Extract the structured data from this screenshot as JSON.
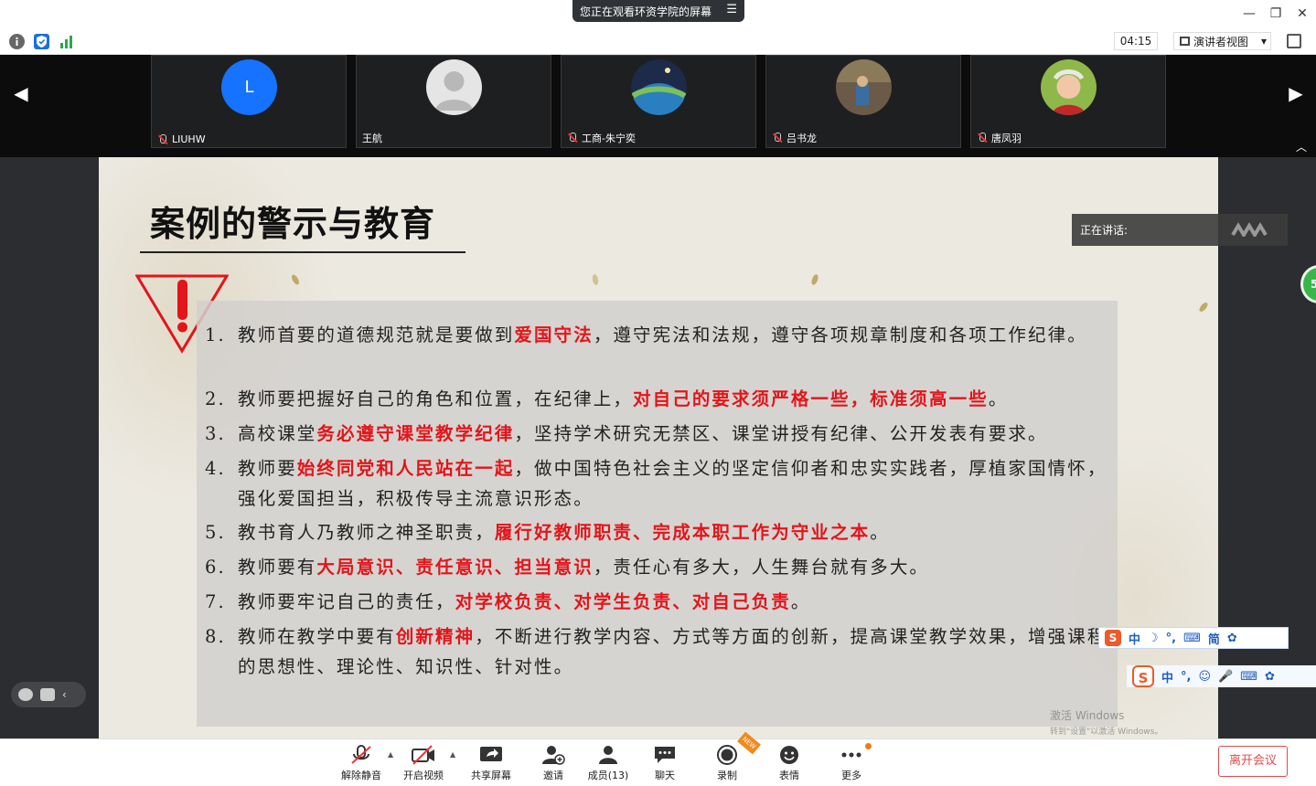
{
  "window": {
    "share_banner": "您正在观看环资学院的屏幕",
    "share_menu_glyph": "☰",
    "minimize_glyph": "—",
    "restore_glyph": "❐",
    "close_glyph": "✕"
  },
  "toolbar": {
    "timer": "04:15",
    "view_label": "演讲者视图",
    "view_caret": "▾"
  },
  "video_strip": {
    "prev_glyph": "◀",
    "next_glyph": "▶",
    "collapse_glyph": "︿",
    "participants": [
      {
        "name": "LIUHW",
        "initial": "L",
        "avatar_color": "#1673ff",
        "muted": true
      },
      {
        "name": "王航",
        "initial": "",
        "avatar_color": "#d9d9d9",
        "muted": false
      },
      {
        "name": "工商-朱宁奕",
        "initial": "",
        "avatar_color": "#1d2a4a",
        "muted": true
      },
      {
        "name": "吕书龙",
        "initial": "",
        "avatar_color": "#6b5a47",
        "muted": true
      },
      {
        "name": "唐凤羽",
        "initial": "",
        "avatar_color": "#8fb84a",
        "muted": true
      }
    ]
  },
  "slide": {
    "title": "案例的警示与教育",
    "items": [
      {
        "num": "1.",
        "parts": [
          {
            "t": "教师首要的道德规范就是要做到",
            "r": false
          },
          {
            "t": "爱国守法",
            "r": true
          },
          {
            "t": "，遵守宪法和法规，遵守各项规章制度和各项工作纪律。",
            "r": false
          }
        ]
      },
      {
        "num": "2.",
        "parts": [
          {
            "t": "教师要把握好自己的角色和位置，在纪律上，",
            "r": false
          },
          {
            "t": "对自己的要求须严格一些，标准须高一些",
            "r": true
          },
          {
            "t": "。",
            "r": false
          }
        ]
      },
      {
        "num": "3.",
        "parts": [
          {
            "t": "高校课堂",
            "r": false
          },
          {
            "t": "务必遵守课堂教学纪律",
            "r": true
          },
          {
            "t": "，坚持学术研究无禁区、课堂讲授有纪律、公开发表有要求。",
            "r": false
          }
        ]
      },
      {
        "num": "4.",
        "parts": [
          {
            "t": "教师要",
            "r": false
          },
          {
            "t": "始终同党和人民站在一起",
            "r": true
          },
          {
            "t": "，做中国特色社会主义的坚定信仰者和忠实实践者，厚植家国情怀，强化爱国担当，积极传导主流意识形态。",
            "r": false
          }
        ]
      },
      {
        "num": "5.",
        "parts": [
          {
            "t": "教书育人乃教师之神圣职责，",
            "r": false
          },
          {
            "t": "履行好教师职责、完成本职工作为守业之本",
            "r": true
          },
          {
            "t": "。",
            "r": false
          }
        ]
      },
      {
        "num": "6.",
        "parts": [
          {
            "t": "教师要有",
            "r": false
          },
          {
            "t": "大局意识、责任意识、担当意识",
            "r": true
          },
          {
            "t": "，责任心有多大，人生舞台就有多大。",
            "r": false
          }
        ]
      },
      {
        "num": "7.",
        "parts": [
          {
            "t": "教师要牢记自己的责任，",
            "r": false
          },
          {
            "t": "对学校负责、对学生负责、对自己负责",
            "r": true
          },
          {
            "t": "。",
            "r": false
          }
        ]
      },
      {
        "num": "8.",
        "parts": [
          {
            "t": "教师在教学中要有",
            "r": false
          },
          {
            "t": "创新精神",
            "r": true
          },
          {
            "t": "，不断进行教学内容、方式等方面的创新，提高课堂教学效果，增强课程的思想性、理论性、知识性、针对性。",
            "r": false
          }
        ]
      }
    ]
  },
  "speaking": {
    "label": "正在讲话:"
  },
  "green_badge": "51",
  "ime_top": {
    "logo": "S",
    "items": [
      "中",
      "☽",
      "°,",
      "⌨",
      "简",
      "✿"
    ]
  },
  "ime_bottom": {
    "logo": "S",
    "items": [
      "中",
      "°,",
      "☺",
      "🎤",
      "⌨",
      "✿",
      "✿"
    ]
  },
  "activate": {
    "line1": "激活 Windows",
    "line2": "转到\"设置\"以激活 Windows。"
  },
  "left_controls": {
    "arrow": "‹"
  },
  "bottom_bar": {
    "items": [
      {
        "label": "解除静音"
      },
      {
        "label": "开启视频"
      },
      {
        "label": "共享屏幕"
      },
      {
        "label": "邀请"
      },
      {
        "label": "成员(13)"
      },
      {
        "label": "聊天"
      },
      {
        "label": "录制"
      },
      {
        "label": "表情"
      },
      {
        "label": "更多"
      }
    ],
    "caret": "▲",
    "new_badge": "NEW",
    "leave_label": "离开会议"
  },
  "colors": {
    "accent_red": "#e3151a",
    "leave_red": "#e14b4b",
    "blue_avatar": "#1673ff"
  }
}
